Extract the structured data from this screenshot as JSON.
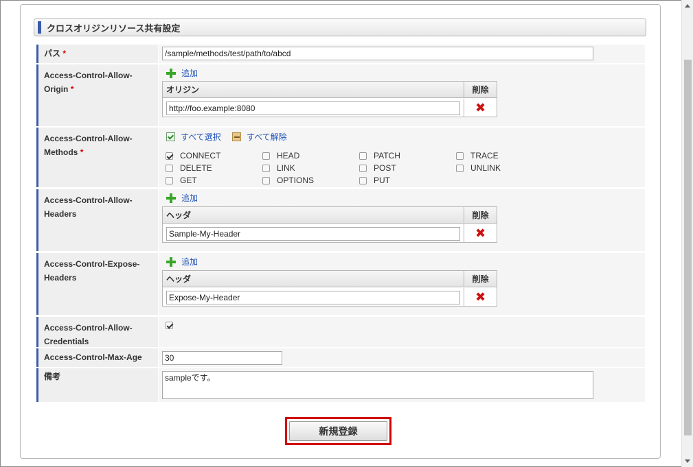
{
  "section_title": "クロスオリジンリソース共有設定",
  "required_mark": "*",
  "path": {
    "label": "パス",
    "value": "/sample/methods/test/path/to/abcd"
  },
  "origin": {
    "label_line1": "Access-Control-Allow-",
    "label_line2": "Origin",
    "add_label": "追加",
    "col_header": "オリジン",
    "del_header": "削除",
    "value": "http://foo.example:8080"
  },
  "methods": {
    "label_line1": "Access-Control-Allow-",
    "label_line2": "Methods",
    "select_all": "すべて選択",
    "deselect_all": "すべて解除",
    "items": [
      {
        "name": "CONNECT",
        "checked": true
      },
      {
        "name": "DELETE",
        "checked": false
      },
      {
        "name": "GET",
        "checked": false
      },
      {
        "name": "HEAD",
        "checked": false
      },
      {
        "name": "LINK",
        "checked": false
      },
      {
        "name": "OPTIONS",
        "checked": false
      },
      {
        "name": "PATCH",
        "checked": false
      },
      {
        "name": "POST",
        "checked": false
      },
      {
        "name": "PUT",
        "checked": false
      },
      {
        "name": "TRACE",
        "checked": false
      },
      {
        "name": "UNLINK",
        "checked": false
      }
    ]
  },
  "allow_headers": {
    "label_line1": "Access-Control-Allow-",
    "label_line2": "Headers",
    "add_label": "追加",
    "col_header": "ヘッダ",
    "del_header": "削除",
    "value": "Sample-My-Header"
  },
  "expose_headers": {
    "label_line1": "Access-Control-Expose-",
    "label_line2": "Headers",
    "add_label": "追加",
    "col_header": "ヘッダ",
    "del_header": "削除",
    "value": "Expose-My-Header"
  },
  "credentials": {
    "label_line1": "Access-Control-Allow-",
    "label_line2": "Credentials",
    "checked": true
  },
  "max_age": {
    "label": "Access-Control-Max-Age",
    "value": "30"
  },
  "note": {
    "label": "備考",
    "value": "sampleです。"
  },
  "submit_label": "新規登録",
  "colors": {
    "accent": "#3a5aa8",
    "required": "#dd0000",
    "highlight": "#d40000",
    "add_icon": "#3aa52b"
  }
}
